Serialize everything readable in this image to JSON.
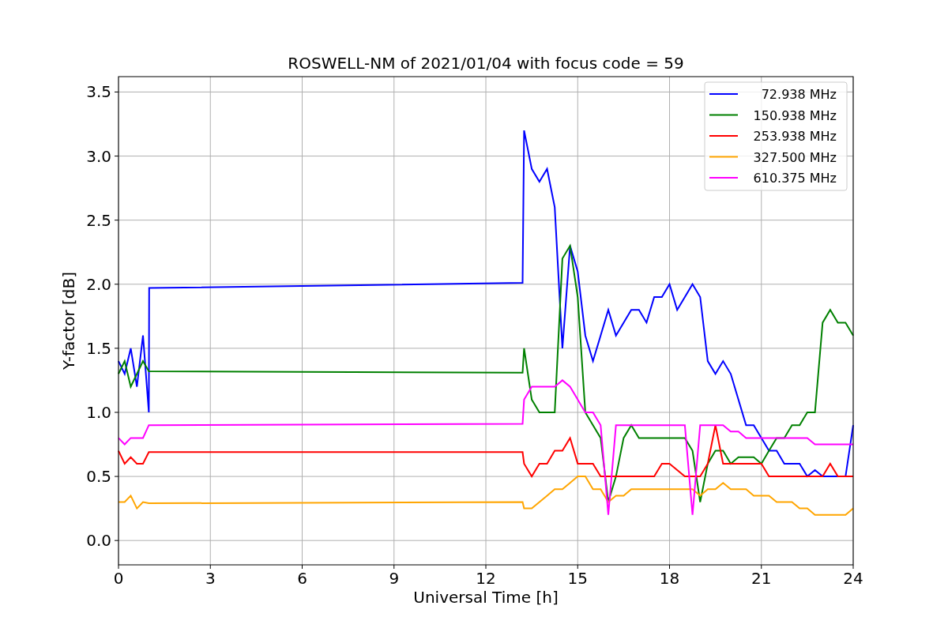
{
  "chart_data": {
    "type": "line",
    "title": "ROSWELL-NM of 2021/01/04 with focus code = 59",
    "xlabel": "Universal Time [h]",
    "ylabel": "Y-factor [dB]",
    "x": [
      0,
      0.2,
      0.4,
      0.6,
      0.8,
      0.99,
      1,
      13.2,
      13.25,
      13.5,
      13.75,
      14,
      14.25,
      14.5,
      14.75,
      15,
      15.25,
      15.5,
      15.75,
      16,
      16.25,
      16.5,
      16.75,
      17,
      17.25,
      17.5,
      17.75,
      18,
      18.25,
      18.5,
      18.75,
      19,
      19.25,
      19.5,
      19.75,
      20,
      20.25,
      20.5,
      20.75,
      21,
      21.25,
      21.5,
      21.75,
      22,
      22.25,
      22.5,
      22.75,
      23,
      23.25,
      23.5,
      23.75,
      24
    ],
    "series": [
      {
        "name": "72.938 MHz",
        "color": "#0000ff",
        "values": [
          1.4,
          1.3,
          1.5,
          1.2,
          1.6,
          1.0,
          1.97,
          2.01,
          3.2,
          2.9,
          2.8,
          2.9,
          2.6,
          1.5,
          2.3,
          2.1,
          1.6,
          1.4,
          1.6,
          1.8,
          1.6,
          1.7,
          1.8,
          1.8,
          1.7,
          1.9,
          1.9,
          2.0,
          1.8,
          1.9,
          2.0,
          1.9,
          1.4,
          1.3,
          1.4,
          1.3,
          1.1,
          0.9,
          0.9,
          0.8,
          0.7,
          0.7,
          0.6,
          0.6,
          0.6,
          0.5,
          0.55,
          0.5,
          0.5,
          0.5,
          0.5,
          0.9
        ]
      },
      {
        "name": "150.938 MHz",
        "color": "#008000",
        "values": [
          1.3,
          1.4,
          1.2,
          1.3,
          1.4,
          1.32,
          1.32,
          1.31,
          1.5,
          1.1,
          1.0,
          1.0,
          1.0,
          2.2,
          2.3,
          1.9,
          1.0,
          0.9,
          0.8,
          0.3,
          0.5,
          0.8,
          0.9,
          0.8,
          0.8,
          0.8,
          0.8,
          0.8,
          0.8,
          0.8,
          0.7,
          0.3,
          0.6,
          0.7,
          0.7,
          0.6,
          0.65,
          0.65,
          0.65,
          0.6,
          0.7,
          0.8,
          0.8,
          0.9,
          0.9,
          1.0,
          1.0,
          1.7,
          1.8,
          1.7,
          1.7,
          1.6
        ]
      },
      {
        "name": "253.938 MHz",
        "color": "#ff0000",
        "values": [
          0.7,
          0.6,
          0.65,
          0.6,
          0.6,
          0.69,
          0.69,
          0.69,
          0.6,
          0.5,
          0.6,
          0.6,
          0.7,
          0.7,
          0.8,
          0.6,
          0.6,
          0.6,
          0.5,
          0.5,
          0.5,
          0.5,
          0.5,
          0.5,
          0.5,
          0.5,
          0.6,
          0.6,
          0.55,
          0.5,
          0.5,
          0.5,
          0.6,
          0.9,
          0.6,
          0.6,
          0.6,
          0.6,
          0.6,
          0.6,
          0.5,
          0.5,
          0.5,
          0.5,
          0.5,
          0.5,
          0.5,
          0.5,
          0.6,
          0.5,
          0.5,
          0.5
        ]
      },
      {
        "name": "327.500 MHz",
        "color": "#ffa500",
        "values": [
          0.3,
          0.3,
          0.35,
          0.25,
          0.3,
          0.29,
          0.29,
          0.3,
          0.25,
          0.25,
          0.3,
          0.35,
          0.4,
          0.4,
          0.45,
          0.5,
          0.5,
          0.4,
          0.4,
          0.3,
          0.35,
          0.35,
          0.4,
          0.4,
          0.4,
          0.4,
          0.4,
          0.4,
          0.4,
          0.4,
          0.4,
          0.35,
          0.4,
          0.4,
          0.45,
          0.4,
          0.4,
          0.4,
          0.35,
          0.35,
          0.35,
          0.3,
          0.3,
          0.3,
          0.25,
          0.25,
          0.2,
          0.2,
          0.2,
          0.2,
          0.2,
          0.25
        ]
      },
      {
        "name": "610.375 MHz",
        "color": "#ff00ff",
        "values": [
          0.8,
          0.75,
          0.8,
          0.8,
          0.8,
          0.9,
          0.9,
          0.91,
          1.1,
          1.2,
          1.2,
          1.2,
          1.2,
          1.25,
          1.2,
          1.1,
          1.0,
          1.0,
          0.9,
          0.2,
          0.9,
          0.9,
          0.9,
          0.9,
          0.9,
          0.9,
          0.9,
          0.9,
          0.9,
          0.9,
          0.2,
          0.9,
          0.9,
          0.9,
          0.9,
          0.85,
          0.85,
          0.8,
          0.8,
          0.8,
          0.8,
          0.8,
          0.8,
          0.8,
          0.8,
          0.8,
          0.75,
          0.75,
          0.75,
          0.75,
          0.75,
          0.75
        ]
      }
    ],
    "grid": true,
    "legend": true,
    "xlim": [
      0,
      24
    ],
    "ylim": [
      -0.19,
      3.62
    ],
    "xticks": [
      0,
      3,
      6,
      9,
      12,
      15,
      18,
      21,
      24
    ],
    "yticks": [
      {
        "value": 0,
        "label": "0.0"
      },
      {
        "value": 0.5,
        "label": "0.5"
      },
      {
        "value": 1,
        "label": "1.0"
      },
      {
        "value": 1.5,
        "label": "1.5"
      },
      {
        "value": 2,
        "label": "2.0"
      },
      {
        "value": 2.5,
        "label": "2.5"
      },
      {
        "value": 3,
        "label": "3.0"
      },
      {
        "value": 3.5,
        "label": "3.5"
      }
    ]
  }
}
